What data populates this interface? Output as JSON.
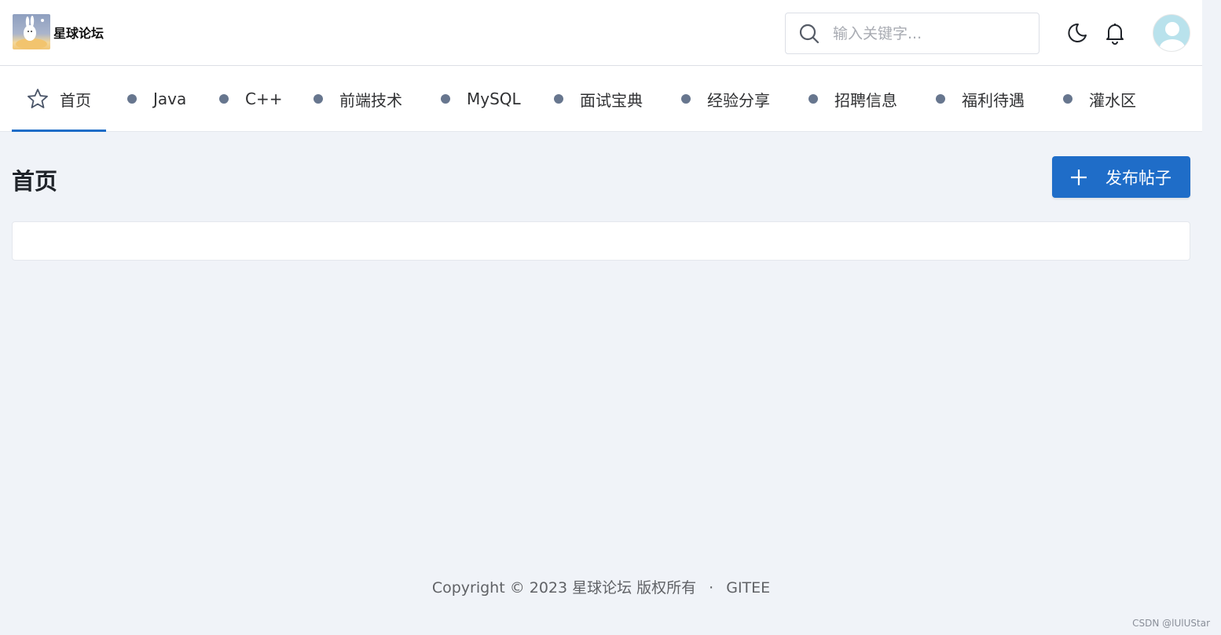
{
  "header": {
    "logo_title": "星球论坛",
    "search": {
      "placeholder": "输入关键字...",
      "value": ""
    }
  },
  "nav": {
    "items": [
      {
        "label": "首页",
        "icon": "star-icon",
        "active": true
      },
      {
        "label": "Java"
      },
      {
        "label": "C++"
      },
      {
        "label": "前端技术"
      },
      {
        "label": "MySQL"
      },
      {
        "label": "面试宝典"
      },
      {
        "label": "经验分享"
      },
      {
        "label": "招聘信息"
      },
      {
        "label": "福利待遇"
      },
      {
        "label": "灌水区"
      }
    ]
  },
  "main": {
    "title": "首页",
    "publish_label": "发布帖子"
  },
  "footer": {
    "copyright": "Copyright © 2023 星球论坛 版权所有",
    "separator": "·",
    "link": "GITEE"
  },
  "watermark": "CSDN @lUlUStar",
  "colors": {
    "accent": "#1f6dc8",
    "background": "#f0f3f8",
    "dot": "#67768e"
  }
}
